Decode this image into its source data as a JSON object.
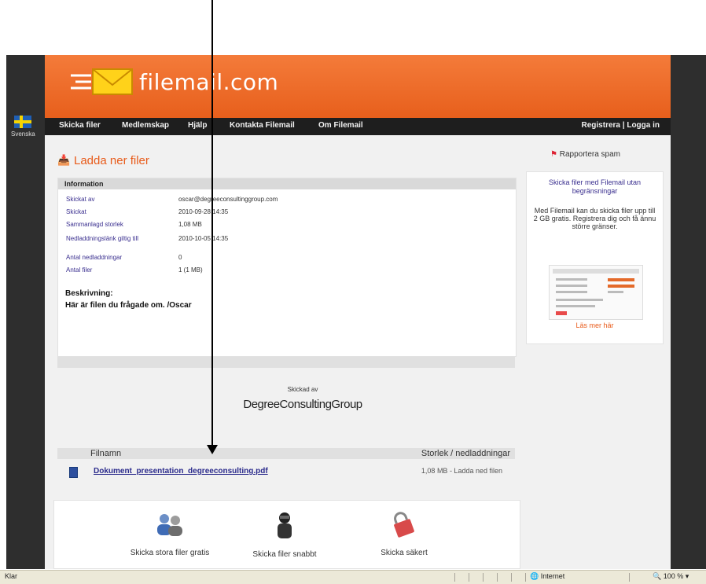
{
  "header": {
    "logo_text": "filemail.com"
  },
  "nav": {
    "items": [
      "Skicka filer",
      "Medlemskap",
      "Hjälp",
      "Kontakta Filemail",
      "Om Filemail"
    ],
    "login": "Registrera | Logga in"
  },
  "lang": {
    "label": "Svenska"
  },
  "page": {
    "title": "Ladda ner filer",
    "report_label": "Rapportera spam"
  },
  "info": {
    "header": "Information",
    "rows": [
      {
        "key": "Skickat av",
        "value": "oscar@degreeconsultinggroup.com"
      },
      {
        "key": "Skickat",
        "value": "2010-09-28 14:35"
      },
      {
        "key": "Sammanlagd storlek",
        "value": "1,08 MB"
      },
      {
        "key": "Nedladdningslänk giltig till",
        "value": "2010-10-05 14:35"
      },
      {
        "key": "Antal nedladdningar",
        "value": "0"
      },
      {
        "key": "Antal filer",
        "value": "1 (1 MB)"
      }
    ],
    "desc_title": "Beskrivning:",
    "desc_text": "Här är filen du frågade om. /Oscar"
  },
  "sender": {
    "label": "Skickad av",
    "name": "DegreeConsultingGroup"
  },
  "files": {
    "col_file": "Filnamn",
    "col_size": "Storlek / nedladdningar",
    "items": [
      {
        "name": "Dokument_presentation_degreeconsulting.pdf",
        "size": "1,08 MB - Ladda ned filen"
      }
    ]
  },
  "features": [
    {
      "label": "Skicka stora filer gratis",
      "icon": "users-icon"
    },
    {
      "label": "Skicka filer snabbt",
      "icon": "rocket-icon"
    },
    {
      "label": "Skicka säkert",
      "icon": "lock-icon"
    }
  ],
  "sidebar": {
    "title": "Skicka filer med Filemail utan begränsningar",
    "text": "Med Filemail kan du skicka filer upp till 2 GB gratis. Registrera dig och få ännu större gränser.",
    "link": "Läs mer här"
  },
  "statusbar": {
    "left": "Klar",
    "zone": "Internet",
    "zoom": "100 %"
  }
}
